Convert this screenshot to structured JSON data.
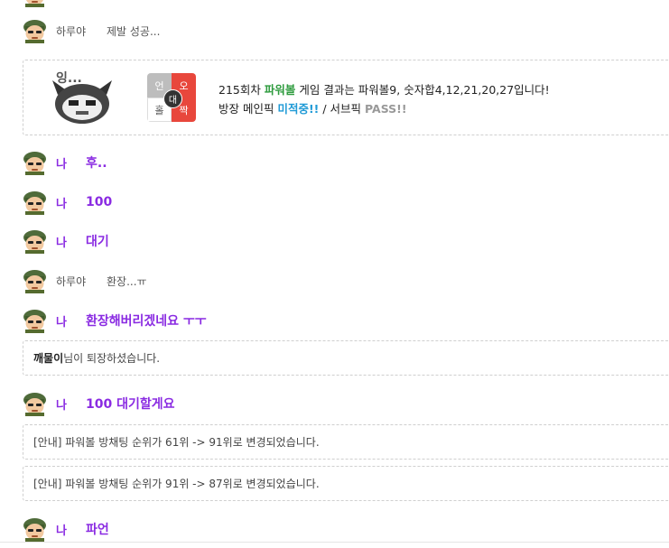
{
  "chat": {
    "m1": {
      "nick": "하루야",
      "text": "제발 성공..."
    },
    "result": {
      "mascot_text": "잉...",
      "grid": {
        "top_left": "언",
        "top_right": "오",
        "bottom_left": "홀",
        "bottom_right": "짝",
        "center": "대"
      },
      "line1_prefix": "215회차",
      "line1_game": "파워볼",
      "line1_suffix": "게임 결과는 파워볼9, 숫자합4,12,21,20,27입니다!",
      "line2_prefix": "방장 메인픽",
      "line2_status": "미적중!!",
      "line2_sep": "/ 서브픽",
      "line2_sub": "PASS!!"
    },
    "m2": {
      "nick": "나",
      "text": "후.."
    },
    "m3": {
      "nick": "나",
      "text": "100"
    },
    "m4": {
      "nick": "나",
      "text": "대기"
    },
    "m5": {
      "nick": "하루야",
      "text": "환장...ㅠ"
    },
    "m6": {
      "nick": "나",
      "text": "환장해버리겠네요 ㅜㅜ"
    },
    "n1": {
      "name": "깨물이",
      "text": "님이 퇴장하셨습니다."
    },
    "m7": {
      "nick": "나",
      "text": "100 대기할게요"
    },
    "n2": {
      "text": "[안내] 파워볼 방채팅 순위가 61위 -> 91위로 변경되었습니다."
    },
    "n3": {
      "text": "[안내] 파워볼 방채팅 순위가 91위 -> 87위로 변경되었습니다."
    },
    "m8": {
      "nick": "나",
      "text": "파언"
    }
  },
  "colors": {
    "me": "#8a2be2",
    "green": "#2e9b3e",
    "blue": "#1f9ad6",
    "red": "#e8473c"
  }
}
